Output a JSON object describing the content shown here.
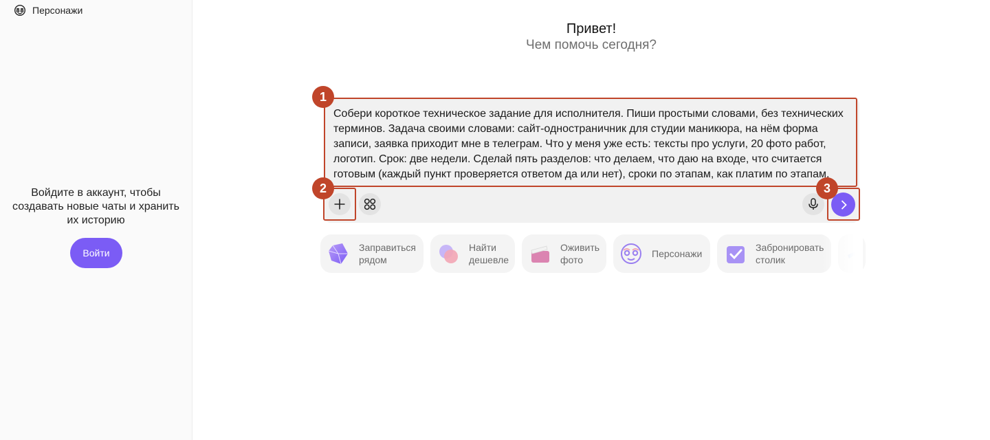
{
  "sidebar": {
    "characters_label": "Персонажи",
    "login_prompt": "Войдите в аккаунт, чтобы\nсоздавать новые чаты и хранить\nих историю",
    "login_button": "Войти"
  },
  "greeting": {
    "title": "Привет!",
    "subtitle": "Чем помочь сегодня?"
  },
  "composer": {
    "prompt_text": "Собери короткое техническое задание для исполнителя. Пиши простыми словами, без технических\nтерминов. Задача своими словами: сайт-одностраничник для студии маникюра, на нём форма\nзаписи, заявка приходит мне в телеграм. Что у меня уже есть: тексты про услуги, 20 фото работ,\nлоготип. Срок: две недели. Сделай пять разделов: что делаем, что даю на входе, что считается\nготовым (каждый пункт проверяется ответом да или нет), сроки по этапам, как платим по этапам.",
    "icons": [
      "plus-icon",
      "apps-icon",
      "microphone-icon",
      "chevron-right-icon"
    ]
  },
  "annotations": [
    "1",
    "2",
    "3"
  ],
  "suggestions": [
    {
      "label": "Заправиться\nрядом",
      "icon": "fuel-crystal-icon"
    },
    {
      "label": "Найти\nдешевле",
      "icon": "price-bubbles-icon"
    },
    {
      "label": "Оживить\nфото",
      "icon": "clapperboard-icon"
    },
    {
      "label": "Персонажи",
      "icon": "character-face-icon"
    },
    {
      "label": "Забронировать\nстолик",
      "icon": "booking-check-icon"
    }
  ],
  "colors": {
    "accent": "#7b5cf5",
    "annotation": "#c0452a",
    "composer_bg": "#f1f1f1",
    "chip_bg": "#f4f4f4"
  }
}
